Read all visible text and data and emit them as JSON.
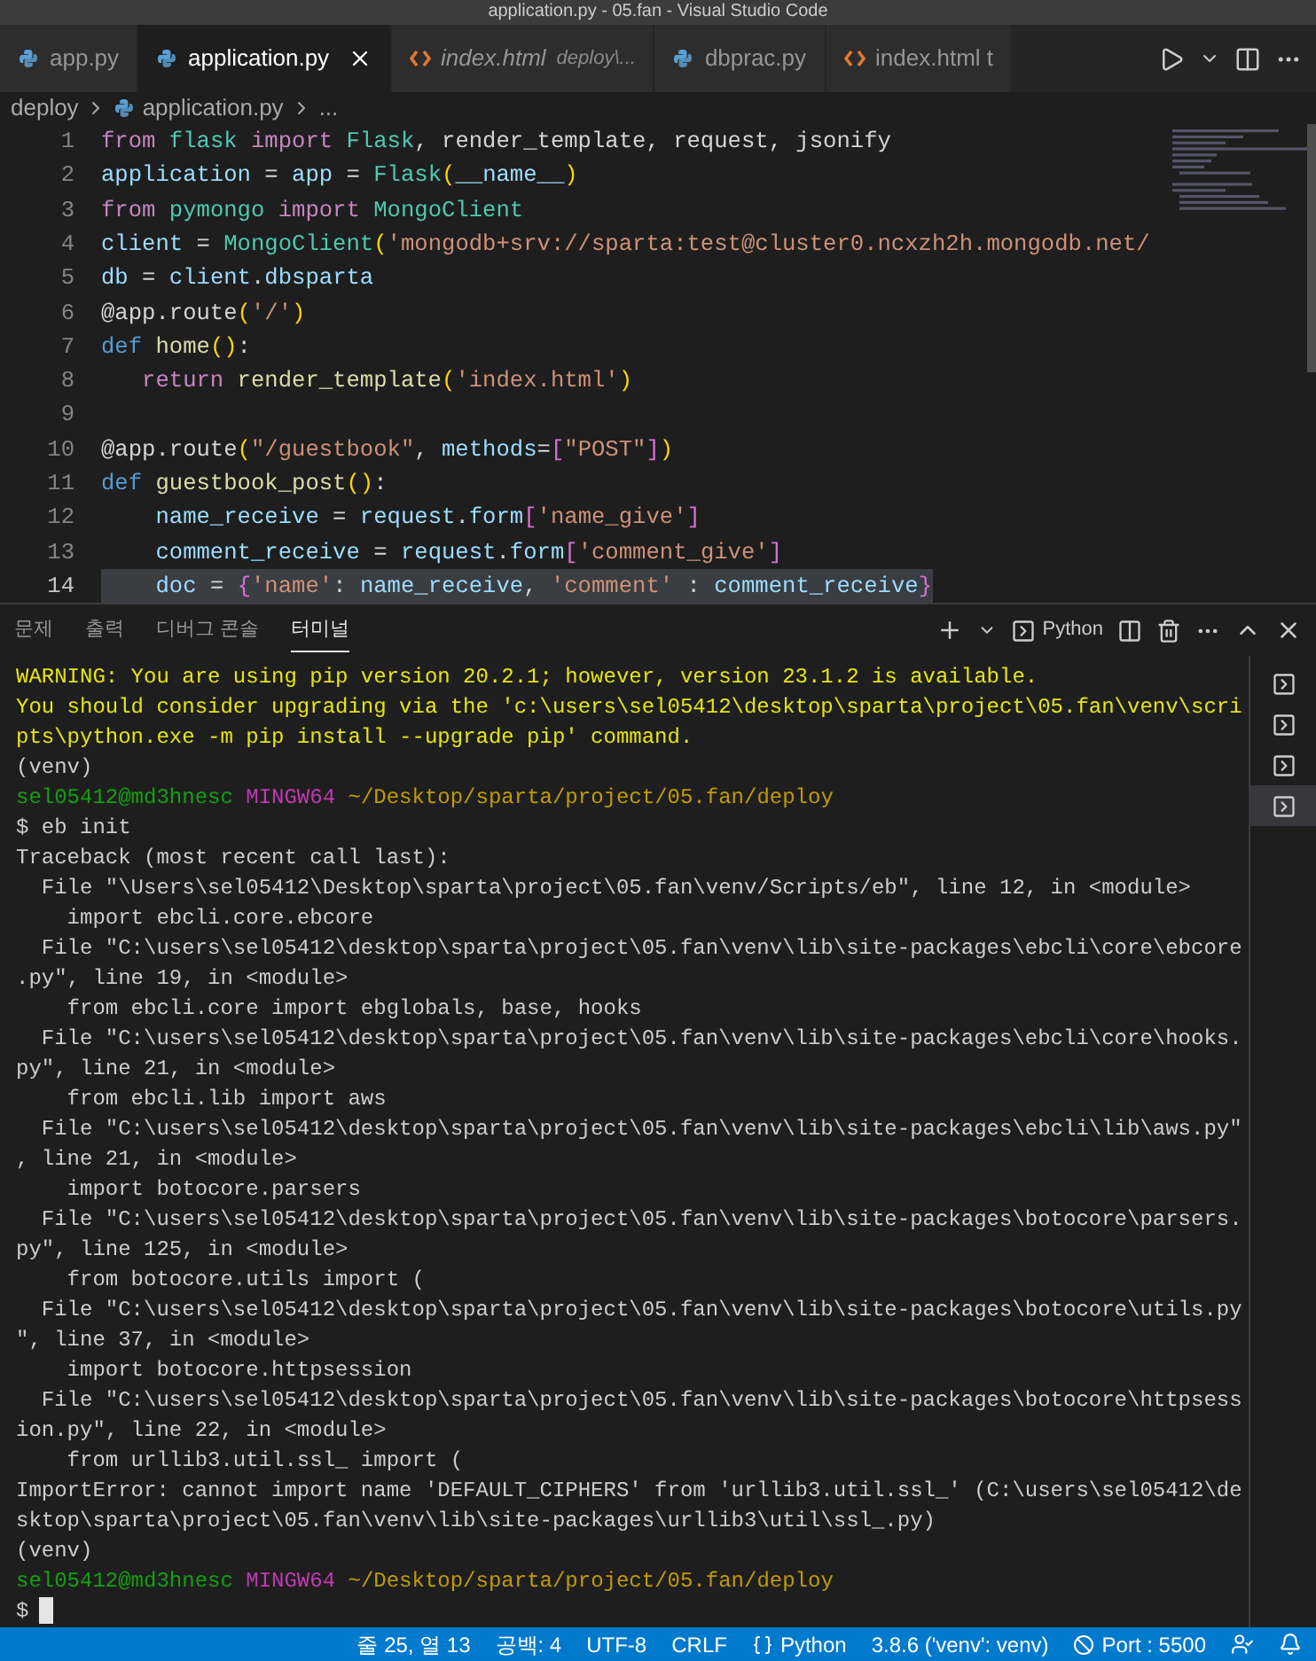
{
  "window": {
    "title": "application.py - 05.fan - Visual Studio Code"
  },
  "tabs": [
    {
      "label": "app.py",
      "kind": "python",
      "selected": false,
      "preview": false
    },
    {
      "label": "application.py",
      "kind": "python",
      "selected": true,
      "preview": false
    },
    {
      "label": "index.html",
      "detail": "deploy\\...",
      "kind": "html",
      "selected": false,
      "preview": true
    },
    {
      "label": "dbprac.py",
      "kind": "python",
      "selected": false,
      "preview": false
    },
    {
      "label": "index.html t",
      "kind": "html",
      "selected": false,
      "preview": false
    }
  ],
  "breadcrumb": [
    "deploy",
    "application.py",
    "..."
  ],
  "code_lines": [
    {
      "number": "1",
      "highlighted": false,
      "tokens": [
        {
          "text": "from ",
          "kind": "kw"
        },
        {
          "text": "flask ",
          "kind": "cls"
        },
        {
          "text": "import ",
          "kind": "kw"
        },
        {
          "text": "Flask",
          "kind": "cls"
        },
        {
          "text": ", render_template, request, jsonify",
          "kind": "plain"
        }
      ]
    },
    {
      "number": "2",
      "highlighted": false,
      "tokens": [
        {
          "text": "application",
          "kind": "var"
        },
        {
          "text": " = ",
          "kind": "plain"
        },
        {
          "text": "app",
          "kind": "var"
        },
        {
          "text": " = ",
          "kind": "plain"
        },
        {
          "text": "Flask",
          "kind": "cls"
        },
        {
          "text": "(",
          "kind": "bracket"
        },
        {
          "text": "__name__",
          "kind": "var"
        },
        {
          "text": ")",
          "kind": "bracket"
        }
      ]
    },
    {
      "number": "3",
      "highlighted": false,
      "tokens": [
        {
          "text": "from ",
          "kind": "kw"
        },
        {
          "text": "pymongo ",
          "kind": "cls"
        },
        {
          "text": "import ",
          "kind": "kw"
        },
        {
          "text": "MongoClient",
          "kind": "cls"
        }
      ]
    },
    {
      "number": "4",
      "highlighted": false,
      "tokens": [
        {
          "text": "client",
          "kind": "var"
        },
        {
          "text": " = ",
          "kind": "plain"
        },
        {
          "text": "MongoClient",
          "kind": "cls"
        },
        {
          "text": "(",
          "kind": "bracket"
        },
        {
          "text": "'mongodb+srv://sparta:test@cluster0.ncxzh2h.mongodb.net/",
          "kind": "str"
        }
      ]
    },
    {
      "number": "5",
      "highlighted": false,
      "tokens": [
        {
          "text": "db",
          "kind": "var"
        },
        {
          "text": " = ",
          "kind": "plain"
        },
        {
          "text": "client",
          "kind": "var"
        },
        {
          "text": ".",
          "kind": "plain"
        },
        {
          "text": "dbsparta",
          "kind": "var"
        }
      ]
    },
    {
      "number": "6",
      "highlighted": false,
      "tokens": [
        {
          "text": "@app.route",
          "kind": "plain"
        },
        {
          "text": "(",
          "kind": "bracket"
        },
        {
          "text": "'/'",
          "kind": "str"
        },
        {
          "text": ")",
          "kind": "bracket"
        }
      ]
    },
    {
      "number": "7",
      "highlighted": false,
      "tokens": [
        {
          "text": "def ",
          "kind": "def"
        },
        {
          "text": "home",
          "kind": "fn"
        },
        {
          "text": "()",
          "kind": "bracket"
        },
        {
          "text": ":",
          "kind": "plain"
        }
      ]
    },
    {
      "number": "8",
      "highlighted": false,
      "tokens": [
        {
          "text": "   return ",
          "kind": "kw"
        },
        {
          "text": "render_template",
          "kind": "fn"
        },
        {
          "text": "(",
          "kind": "bracket"
        },
        {
          "text": "'index.html'",
          "kind": "str"
        },
        {
          "text": ")",
          "kind": "bracket"
        }
      ]
    },
    {
      "number": "9",
      "highlighted": false
    },
    {
      "number": "10",
      "highlighted": false,
      "tokens": [
        {
          "text": "@app.route",
          "kind": "plain"
        },
        {
          "text": "(",
          "kind": "bracket"
        },
        {
          "text": "\"/guestbook\"",
          "kind": "str"
        },
        {
          "text": ", ",
          "kind": "plain"
        },
        {
          "text": "methods",
          "kind": "var"
        },
        {
          "text": "=",
          "kind": "plain"
        },
        {
          "text": "[",
          "kind": "bracket2"
        },
        {
          "text": "\"POST\"",
          "kind": "str"
        },
        {
          "text": "]",
          "kind": "bracket2"
        },
        {
          "text": ")",
          "kind": "bracket"
        }
      ]
    },
    {
      "number": "11",
      "highlighted": false,
      "tokens": [
        {
          "text": "def ",
          "kind": "def"
        },
        {
          "text": "guestbook_post",
          "kind": "fn"
        },
        {
          "text": "()",
          "kind": "bracket"
        },
        {
          "text": ":",
          "kind": "plain"
        }
      ]
    },
    {
      "number": "12",
      "highlighted": false,
      "tokens": [
        {
          "text": "    name_receive",
          "kind": "var"
        },
        {
          "text": " = ",
          "kind": "plain"
        },
        {
          "text": "request",
          "kind": "var"
        },
        {
          "text": ".",
          "kind": "plain"
        },
        {
          "text": "form",
          "kind": "var"
        },
        {
          "text": "[",
          "kind": "bracket2"
        },
        {
          "text": "'name_give'",
          "kind": "str"
        },
        {
          "text": "]",
          "kind": "bracket2"
        }
      ]
    },
    {
      "number": "13",
      "highlighted": false,
      "tokens": [
        {
          "text": "    comment_receive",
          "kind": "var"
        },
        {
          "text": " = ",
          "kind": "plain"
        },
        {
          "text": "request",
          "kind": "var"
        },
        {
          "text": ".",
          "kind": "plain"
        },
        {
          "text": "form",
          "kind": "var"
        },
        {
          "text": "[",
          "kind": "bracket2"
        },
        {
          "text": "'comment_give'",
          "kind": "str"
        },
        {
          "text": "]",
          "kind": "bracket2"
        }
      ]
    },
    {
      "number": "14",
      "highlighted": true,
      "tokens": [
        {
          "text": "    doc",
          "kind": "var"
        },
        {
          "text": " = ",
          "kind": "plain"
        },
        {
          "text": "{",
          "kind": "bracket2"
        },
        {
          "text": "'name'",
          "kind": "str"
        },
        {
          "text": ": ",
          "kind": "plain"
        },
        {
          "text": "name_receive",
          "kind": "var"
        },
        {
          "text": ", ",
          "kind": "plain"
        },
        {
          "text": "'comment'",
          "kind": "str"
        },
        {
          "text": " : ",
          "kind": "plain"
        },
        {
          "text": "comment_receive",
          "kind": "var"
        },
        {
          "text": "}",
          "kind": "bracket2"
        }
      ]
    }
  ],
  "panel_tabs": [
    {
      "label": "문제",
      "selected": false
    },
    {
      "label": "출력",
      "selected": false
    },
    {
      "label": "디버그 콘솔",
      "selected": false
    },
    {
      "label": "터미널",
      "selected": true
    }
  ],
  "terminal_profile": "Python",
  "terminal_lines": [
    {
      "kind": "warning",
      "text": "WARNING: You are using pip version 20.2.1; however, version 23.1.2 is available."
    },
    {
      "kind": "warning",
      "text": "You should consider upgrading via the 'c:\\users\\sel05412\\desktop\\sparta\\project\\05.fan\\venv\\scri"
    },
    {
      "kind": "warning",
      "text": "pts\\python.exe -m pip install --upgrade pip' command."
    },
    {
      "kind": "plain",
      "text": "(venv)"
    },
    {
      "kind": "prompt",
      "user": "sel05412@md3hnesc",
      "shell": "MINGW64",
      "path": "~/Desktop/sparta/project/05.fan/deploy"
    },
    {
      "kind": "plain",
      "text": "$ eb init"
    },
    {
      "kind": "plain",
      "text": "Traceback (most recent call last):"
    },
    {
      "kind": "plain",
      "text": "  File \"\\Users\\sel05412\\Desktop\\sparta\\project\\05.fan\\venv/Scripts/eb\", line 12, in <module>"
    },
    {
      "kind": "plain",
      "text": "    import ebcli.core.ebcore"
    },
    {
      "kind": "plain",
      "text": "  File \"C:\\users\\sel05412\\desktop\\sparta\\project\\05.fan\\venv\\lib\\site-packages\\ebcli\\core\\ebcore"
    },
    {
      "kind": "plain",
      "text": ".py\", line 19, in <module>"
    },
    {
      "kind": "plain",
      "text": "    from ebcli.core import ebglobals, base, hooks"
    },
    {
      "kind": "plain",
      "text": "  File \"C:\\users\\sel05412\\desktop\\sparta\\project\\05.fan\\venv\\lib\\site-packages\\ebcli\\core\\hooks."
    },
    {
      "kind": "plain",
      "text": "py\", line 21, in <module>"
    },
    {
      "kind": "plain",
      "text": "    from ebcli.lib import aws"
    },
    {
      "kind": "plain",
      "text": "  File \"C:\\users\\sel05412\\desktop\\sparta\\project\\05.fan\\venv\\lib\\site-packages\\ebcli\\lib\\aws.py\""
    },
    {
      "kind": "plain",
      "text": ", line 21, in <module>"
    },
    {
      "kind": "plain",
      "text": "    import botocore.parsers"
    },
    {
      "kind": "plain",
      "text": "  File \"C:\\users\\sel05412\\desktop\\sparta\\project\\05.fan\\venv\\lib\\site-packages\\botocore\\parsers."
    },
    {
      "kind": "plain",
      "text": "py\", line 125, in <module>"
    },
    {
      "kind": "plain",
      "text": "    from botocore.utils import ("
    },
    {
      "kind": "plain",
      "text": "  File \"C:\\users\\sel05412\\desktop\\sparta\\project\\05.fan\\venv\\lib\\site-packages\\botocore\\utils.py"
    },
    {
      "kind": "plain",
      "text": "\", line 37, in <module>"
    },
    {
      "kind": "plain",
      "text": "    import botocore.httpsession"
    },
    {
      "kind": "plain",
      "text": "  File \"C:\\users\\sel05412\\desktop\\sparta\\project\\05.fan\\venv\\lib\\site-packages\\botocore\\httpsess"
    },
    {
      "kind": "plain",
      "text": "ion.py\", line 22, in <module>"
    },
    {
      "kind": "plain",
      "text": "    from urllib3.util.ssl_ import ("
    },
    {
      "kind": "plain",
      "text": "ImportError: cannot import name 'DEFAULT_CIPHERS' from 'urllib3.util.ssl_' (C:\\users\\sel05412\\de"
    },
    {
      "kind": "plain",
      "text": "sktop\\sparta\\project\\05.fan\\venv\\lib\\site-packages\\urllib3\\util\\ssl_.py)"
    },
    {
      "kind": "plain",
      "text": "(venv)"
    },
    {
      "kind": "prompt",
      "user": "sel05412@md3hnesc",
      "shell": "MINGW64",
      "path": "~/Desktop/sparta/project/05.fan/deploy"
    },
    {
      "kind": "input",
      "text": "$"
    }
  ],
  "terminal_list": [
    {
      "selected": false
    },
    {
      "selected": false
    },
    {
      "selected": false
    },
    {
      "selected": true
    }
  ],
  "status_bar": {
    "position": "줄 25, 열 13",
    "indent": "공백: 4",
    "encoding": "UTF-8",
    "eol": "CRLF",
    "language": "Python",
    "interpreter": "3.8.6 ('venv': venv)",
    "port": "Port : 5500"
  }
}
